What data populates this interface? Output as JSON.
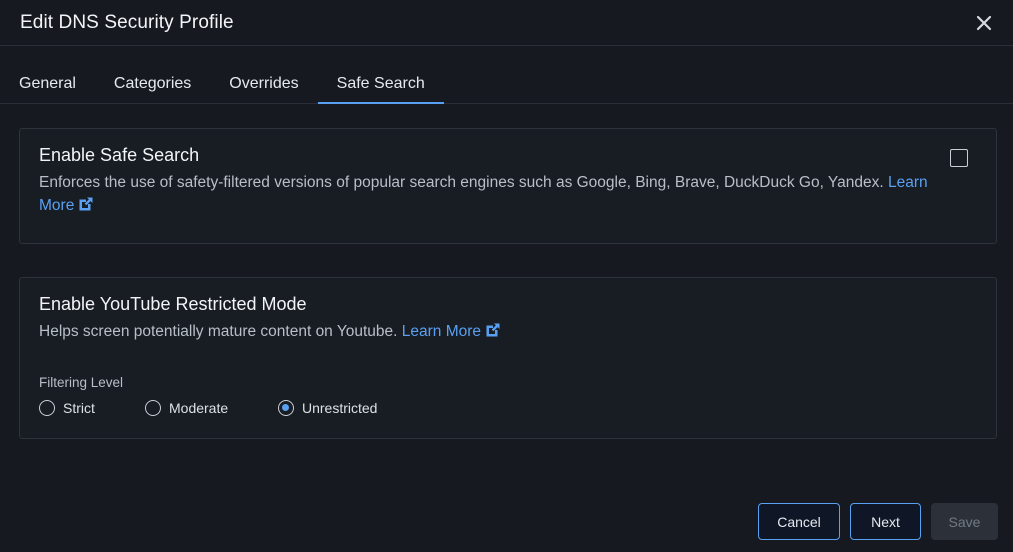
{
  "dialog": {
    "title": "Edit DNS Security Profile",
    "close_icon": "close-icon"
  },
  "tabs": [
    {
      "label": "General"
    },
    {
      "label": "Categories"
    },
    {
      "label": "Overrides"
    },
    {
      "label": "Safe Search",
      "active": true
    }
  ],
  "safe_search": {
    "title": "Enable Safe Search",
    "description": "Enforces the use of safety-filtered versions of popular search engines such as Google, Bing, Brave, DuckDuck Go, Yandex.",
    "learn_more_1": "Learn",
    "learn_more_2": "More",
    "link_icon": "external-link-icon",
    "checked": false
  },
  "youtube": {
    "title": "Enable YouTube Restricted Mode",
    "description": "Helps screen potentially mature content on Youtube.",
    "learn_more": "Learn More",
    "link_icon": "external-link-icon",
    "filtering_label": "Filtering Level",
    "options": [
      {
        "label": "Strict",
        "selected": false
      },
      {
        "label": "Moderate",
        "selected": false
      },
      {
        "label": "Unrestricted",
        "selected": true
      }
    ]
  },
  "footer": {
    "cancel_label": "Cancel",
    "next_label": "Next",
    "save_label": "Save"
  },
  "colors": {
    "accent": "#5aa0f2",
    "background": "#161a20",
    "card": "#181c23"
  }
}
